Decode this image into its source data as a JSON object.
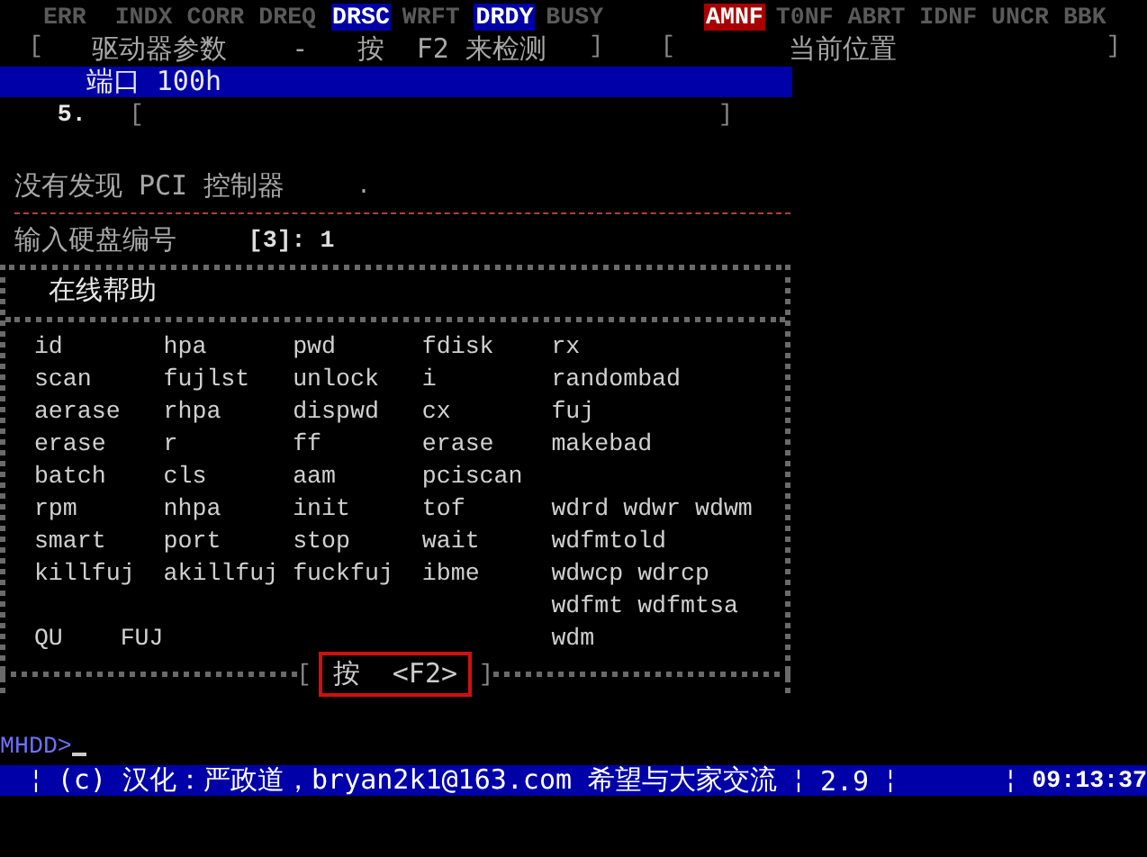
{
  "status_flags": [
    {
      "label": "ERR",
      "on": false
    },
    {
      "label": "INDX",
      "on": false
    },
    {
      "label": "CORR",
      "on": false
    },
    {
      "label": "DREQ",
      "on": false
    },
    {
      "label": "DRSC",
      "on": true
    },
    {
      "label": "WRFT",
      "on": false
    },
    {
      "label": "DRDY",
      "on": true
    },
    {
      "label": "BUSY",
      "on": false
    }
  ],
  "error_flags": [
    {
      "label": "AMNF",
      "on": true
    },
    {
      "label": "T0NF",
      "on": false
    },
    {
      "label": "ABRT",
      "on": false
    },
    {
      "label": "IDNF",
      "on": false
    },
    {
      "label": "UNCR",
      "on": false
    },
    {
      "label": "BBK",
      "on": false
    }
  ],
  "drive_panel": {
    "open": "[",
    "text": "驱动器参数    -   按  F2 来检测",
    "close": "]"
  },
  "position_panel": {
    "open": "[",
    "text": "当前位置",
    "close": "]"
  },
  "port_bar": {
    "text": "端口 100h"
  },
  "drive_line": {
    "number": "5.",
    "open": "[",
    "close": "]"
  },
  "message": {
    "text": "没有发现 PCI 控制器",
    "dot": "."
  },
  "input_line": {
    "label": "输入硬盘编号",
    "value": "[3]: 1"
  },
  "help": {
    "title": "在线帮助",
    "rows": [
      {
        "kind": "grid",
        "cells": [
          "id",
          "hpa",
          "pwd",
          "fdisk",
          "rx"
        ]
      },
      {
        "kind": "grid",
        "cells": [
          "scan",
          "fujlst",
          "unlock",
          "i",
          "randombad"
        ]
      },
      {
        "kind": "grid",
        "cells": [
          "aerase",
          "rhpa",
          "dispwd",
          "cx",
          "fuj"
        ]
      },
      {
        "kind": "grid",
        "cells": [
          "erase",
          "r",
          "ff",
          "erase",
          "makebad"
        ]
      },
      {
        "kind": "grid",
        "cells": [
          "batch",
          "cls",
          "aam",
          "pciscan",
          null
        ]
      },
      {
        "kind": "grid",
        "cells": [
          "rpm",
          "nhpa",
          "init",
          "tof",
          "wdrd wdwr wdwm"
        ]
      },
      {
        "kind": "grid",
        "cells": [
          "smart",
          "port",
          "stop",
          "wait",
          "wdfmtold"
        ]
      },
      {
        "kind": "grid",
        "cells": [
          "killfuj",
          "akillfuj",
          "fuckfuj",
          "ibme",
          "wdwcp wdrcp"
        ]
      },
      {
        "kind": "grid",
        "cells": [
          null,
          null,
          null,
          null,
          "wdfmt wdfmtsa"
        ]
      },
      {
        "kind": "compact",
        "cells": [
          "QU",
          "FUJ",
          null,
          null,
          "wdm"
        ]
      }
    ],
    "hint": {
      "open": "[",
      "label": "按  <F2>",
      "close": "]"
    }
  },
  "prompt": "MHDD>",
  "status_bar": {
    "separator": "¦",
    "items": [
      "(c) 汉化：严政道，bryan2k1@163.com 希望与大家交流",
      "2.9"
    ],
    "time": "09:13:37"
  }
}
